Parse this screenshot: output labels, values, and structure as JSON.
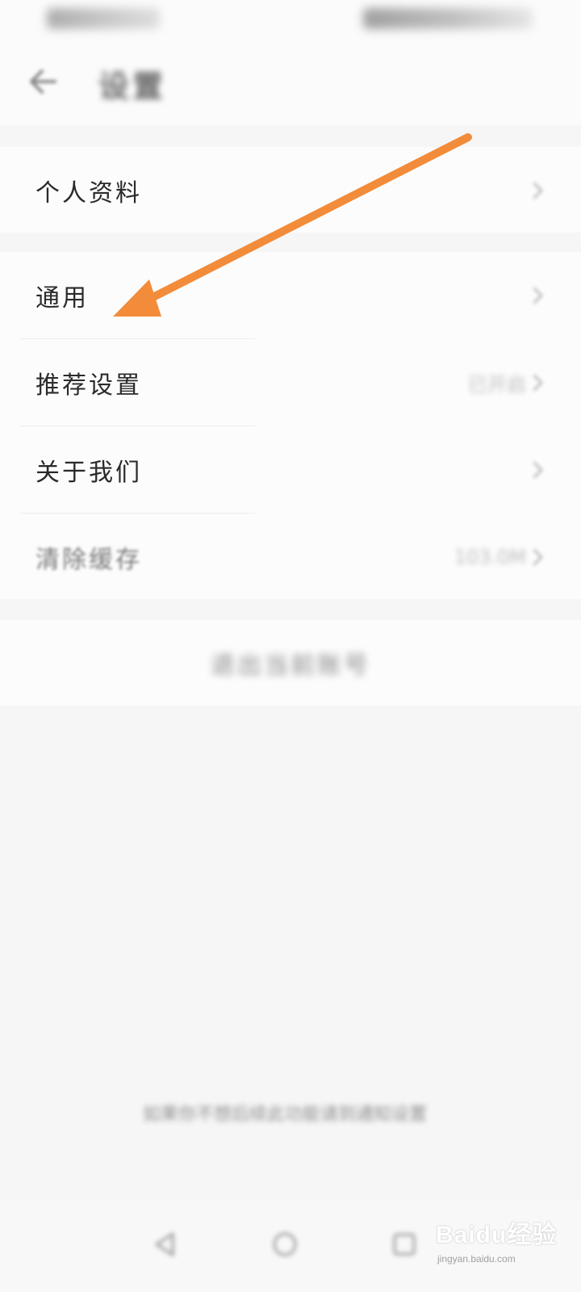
{
  "status_bar": {},
  "header": {
    "title": "设置",
    "back_icon": "arrow-left-icon"
  },
  "groups": [
    {
      "items": [
        {
          "label": "个人资料",
          "value": "",
          "icon": "chevron-right-icon"
        }
      ]
    },
    {
      "items": [
        {
          "label": "通用",
          "value": "",
          "icon": "chevron-right-icon"
        },
        {
          "label": "推荐设置",
          "value": "已开启",
          "icon": "chevron-right-icon"
        },
        {
          "label": "关于我们",
          "value": "",
          "icon": "chevron-right-icon"
        },
        {
          "label": "清除缓存",
          "value": "103.0M",
          "icon": "chevron-right-icon"
        }
      ]
    }
  ],
  "logout": {
    "label": "退出当前账号"
  },
  "footer": {
    "line1": "如果你不想后续此功能请到通知设置",
    "line2": ""
  },
  "navigation": {
    "icons": [
      "nav-back-icon",
      "nav-home-icon",
      "nav-recent-icon"
    ]
  },
  "watermark": {
    "text": "Baidu经验",
    "sub": "jingyan.baidu.com"
  },
  "annotation": {
    "color": "#F28C3A",
    "target": "通用"
  }
}
